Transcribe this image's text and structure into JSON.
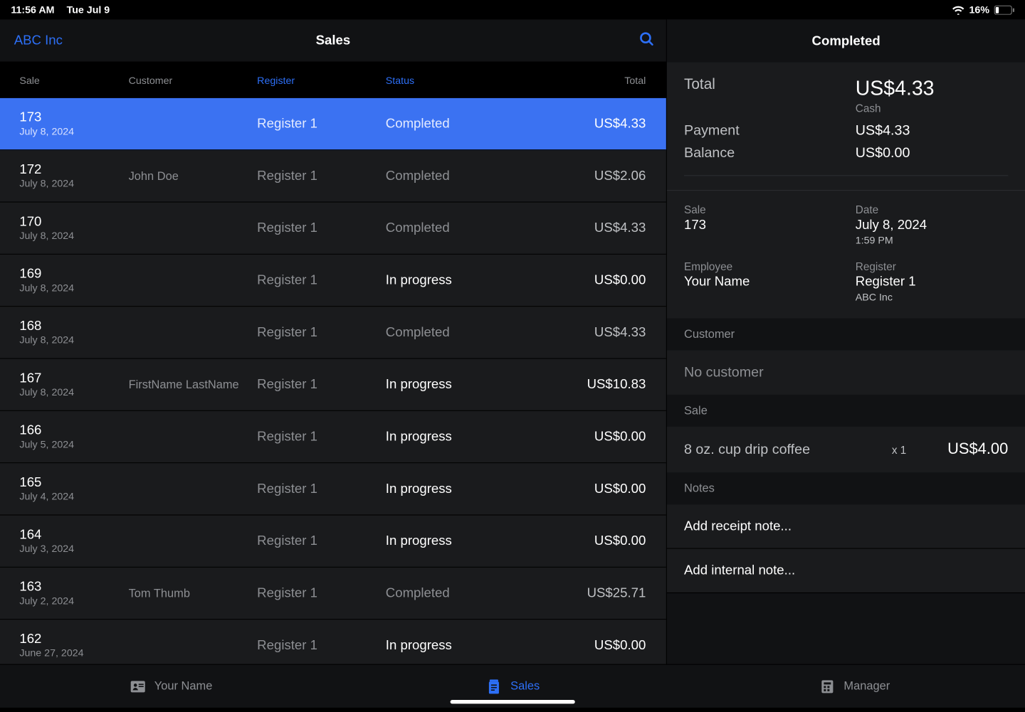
{
  "status_bar": {
    "time": "11:56 AM",
    "date": "Tue Jul 9",
    "battery_pct": "16%"
  },
  "left_header": {
    "brand": "ABC Inc",
    "title": "Sales"
  },
  "columns": {
    "sale": "Sale",
    "customer": "Customer",
    "register": "Register",
    "status": "Status",
    "total": "Total"
  },
  "rows": [
    {
      "id": "173",
      "date": "July 8, 2024",
      "customer": "",
      "register": "Register 1",
      "status": "Completed",
      "total": "US$4.33",
      "selected": true
    },
    {
      "id": "172",
      "date": "July 8, 2024",
      "customer": "John Doe",
      "register": "Register 1",
      "status": "Completed",
      "total": "US$2.06",
      "selected": false
    },
    {
      "id": "170",
      "date": "July 8, 2024",
      "customer": "",
      "register": "Register 1",
      "status": "Completed",
      "total": "US$4.33",
      "selected": false
    },
    {
      "id": "169",
      "date": "July 8, 2024",
      "customer": "",
      "register": "Register 1",
      "status": "In progress",
      "total": "US$0.00",
      "selected": false
    },
    {
      "id": "168",
      "date": "July 8, 2024",
      "customer": "",
      "register": "Register 1",
      "status": "Completed",
      "total": "US$4.33",
      "selected": false
    },
    {
      "id": "167",
      "date": "July 8, 2024",
      "customer": "FirstName LastName",
      "register": "Register 1",
      "status": "In progress",
      "total": "US$10.83",
      "selected": false
    },
    {
      "id": "166",
      "date": "July 5, 2024",
      "customer": "",
      "register": "Register 1",
      "status": "In progress",
      "total": "US$0.00",
      "selected": false
    },
    {
      "id": "165",
      "date": "July 4, 2024",
      "customer": "",
      "register": "Register 1",
      "status": "In progress",
      "total": "US$0.00",
      "selected": false
    },
    {
      "id": "164",
      "date": "July 3, 2024",
      "customer": "",
      "register": "Register 1",
      "status": "In progress",
      "total": "US$0.00",
      "selected": false
    },
    {
      "id": "163",
      "date": "July 2, 2024",
      "customer": "Tom Thumb",
      "register": "Register 1",
      "status": "Completed",
      "total": "US$25.71",
      "selected": false
    },
    {
      "id": "162",
      "date": "June 27, 2024",
      "customer": "",
      "register": "Register 1",
      "status": "In progress",
      "total": "US$0.00",
      "selected": false
    }
  ],
  "detail": {
    "title": "Completed",
    "total_label": "Total",
    "total_value": "US$4.33",
    "total_method": "Cash",
    "payment_label": "Payment",
    "payment_value": "US$4.33",
    "balance_label": "Balance",
    "balance_value": "US$0.00",
    "sale_label": "Sale",
    "sale_value": "173",
    "date_label": "Date",
    "date_value": "July 8, 2024",
    "date_time": "1:59 PM",
    "employee_label": "Employee",
    "employee_value": "Your Name",
    "register_label": "Register",
    "register_value": "Register 1",
    "register_sub": "ABC Inc",
    "customer_header": "Customer",
    "no_customer": "No customer",
    "sale_header": "Sale",
    "line_items": [
      {
        "name": "8 oz. cup drip coffee",
        "qty": "x 1",
        "price": "US$4.00"
      }
    ],
    "notes_header": "Notes",
    "add_receipt_note": "Add receipt note...",
    "add_internal_note": "Add internal note..."
  },
  "tabs": {
    "profile": "Your Name",
    "sales": "Sales",
    "manager": "Manager"
  }
}
